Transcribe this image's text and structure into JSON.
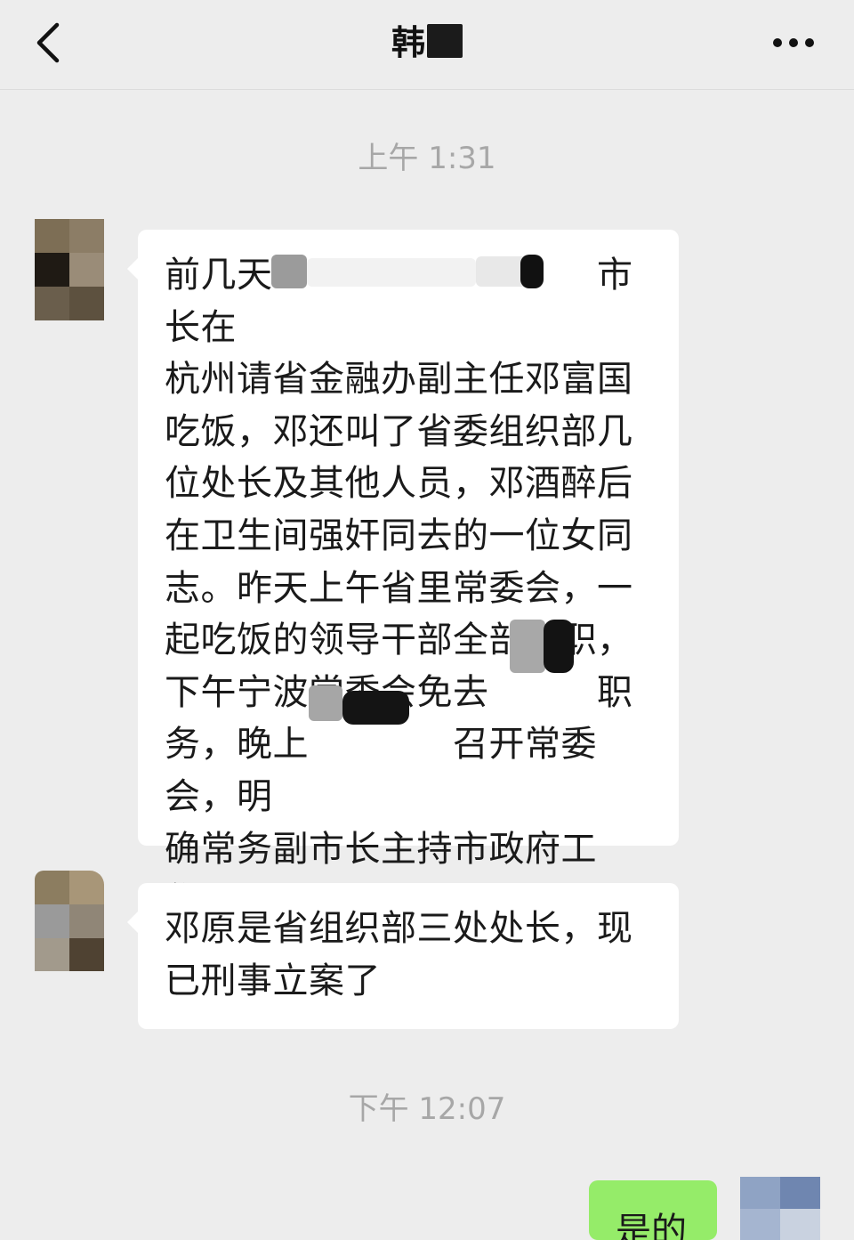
{
  "header": {
    "back_icon": "chevron-left-icon",
    "title": "韩",
    "more_icon": "more-dots-icon"
  },
  "timestamps": [
    "上午 1:31",
    "下午 12:07"
  ],
  "messages": [
    {
      "sender": "incoming",
      "text": "前几天　　　　　　　　　市长在\n杭州请省金融办副主任邓富国\n吃饭，邓还叫了省委组织部几\n位处长及其他人员，邓酒醉后\n在卫生间强奸同去的一位女同\n志。昨天上午省里常委会，一\n起吃饭的领导干部全部免职，\n下午宁波常委会免去　　　职\n务，晚上　　　　召开常委会，明\n确常务副市长主持市政府工\n作。"
    },
    {
      "sender": "incoming",
      "text": "邓原是省组织部三处处长，现\n已刑事立案了"
    },
    {
      "sender": "outgoing",
      "text": "是的"
    }
  ],
  "colors": {
    "background": "#ededed",
    "incoming_bubble": "#ffffff",
    "outgoing_bubble": "#95ec69",
    "timestamp": "#a7a7a7"
  }
}
